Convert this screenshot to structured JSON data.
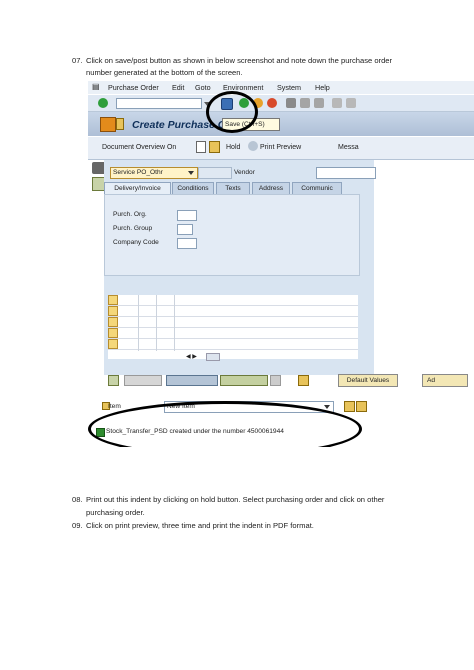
{
  "step07": {
    "num": "07.",
    "line1": "Click on save/post button as shown in below screenshot and note down the purchase order",
    "line2": "number generated at the bottom of the screen."
  },
  "screenshot": {
    "menu": [
      "Purchase Order",
      "Edit",
      "Goto",
      "Environment",
      "System",
      "Help"
    ],
    "title": "Create Purchase O",
    "tooltip": "Save  (Ctrl+S)",
    "appbar": [
      "Document Overview On",
      "Hold",
      "Print Preview",
      "Messa"
    ],
    "po_type": "Service PO_Othr",
    "vendor_label": "Vendor",
    "tabs": [
      "Delivery/Invoice",
      "Conditions",
      "Texts",
      "Address",
      "Communic"
    ],
    "fields": [
      "Purch. Org.",
      "Purch. Group",
      "Company Code"
    ],
    "default_values_button": "Default Values",
    "ad_button": "Ad",
    "item_label": "Item",
    "item_value": "New Item",
    "status_message": "Stock_Transfer_PSD created under the number 4500061944"
  },
  "step08": {
    "num": "08.",
    "line1": "Print out this indent by clicking on hold button. Select purchasing order and click on other",
    "line2": "purchasing order."
  },
  "step09": {
    "num": "09.",
    "line1": "Click on print preview, three time and print the indent in PDF format."
  },
  "colors": {
    "accent": "#10305a",
    "highlight": "#f4d77a",
    "status_ok": "#2e8b2e"
  }
}
